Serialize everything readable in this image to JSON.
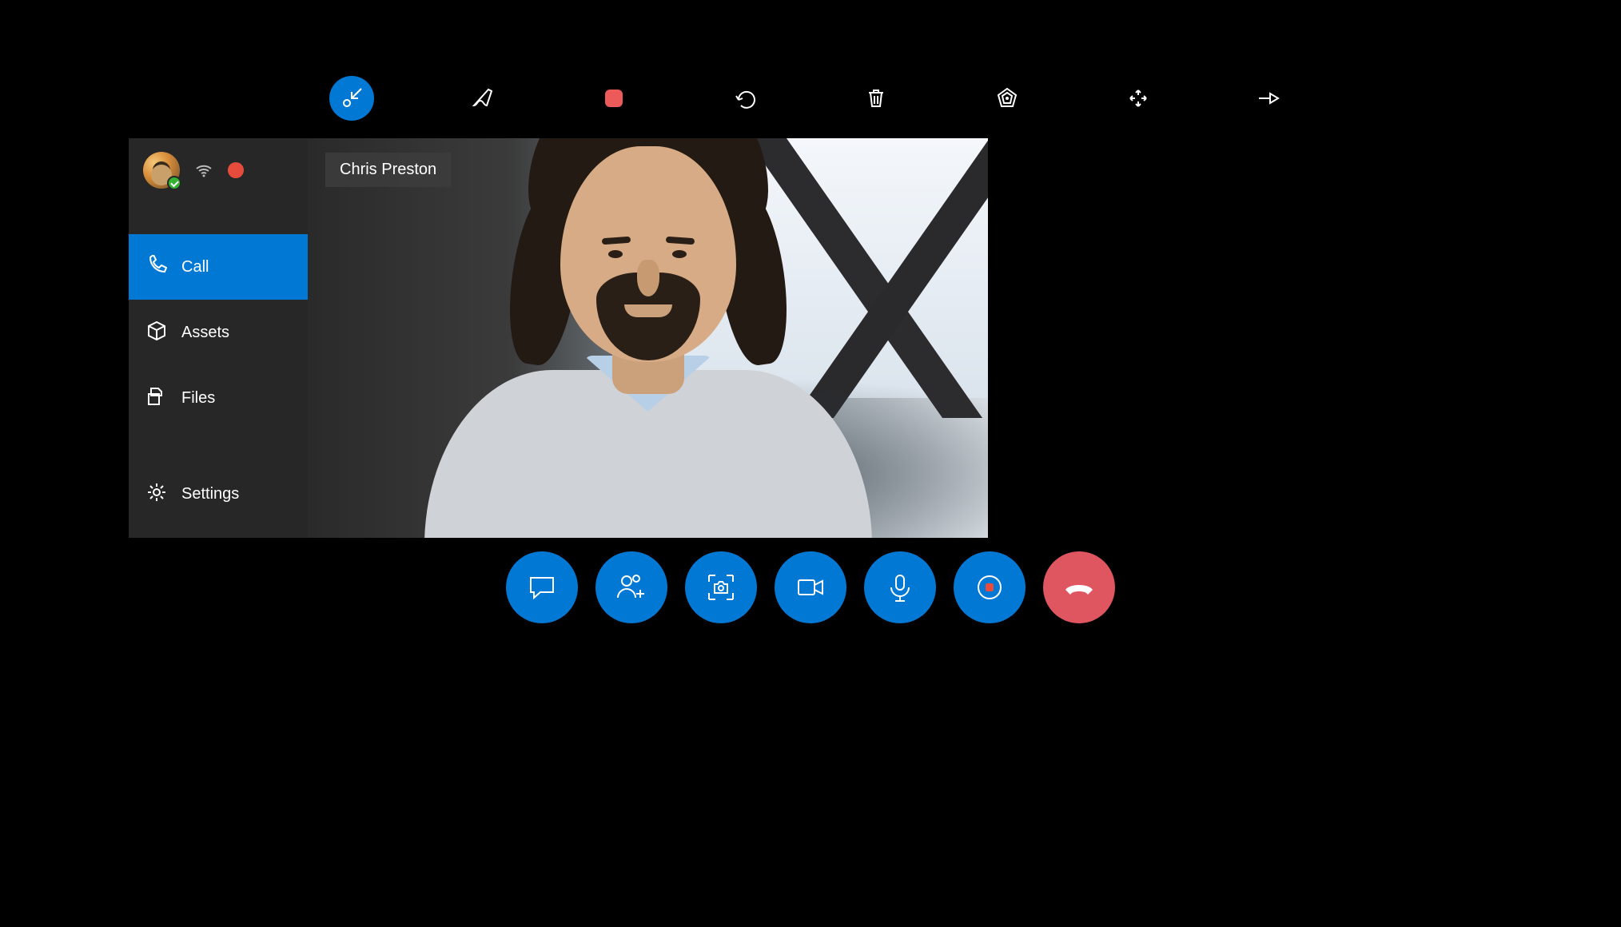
{
  "colors": {
    "accent": "#0078D4",
    "danger": "#e05660",
    "record": "#e74c3c",
    "stopSquare": "#EC5A5A"
  },
  "topToolbar": {
    "items": [
      {
        "name": "collapse-icon",
        "active": true
      },
      {
        "name": "pen-icon",
        "active": false
      },
      {
        "name": "stop-icon",
        "active": false
      },
      {
        "name": "undo-icon",
        "active": false
      },
      {
        "name": "trash-icon",
        "active": false
      },
      {
        "name": "polygon-icon",
        "active": false
      },
      {
        "name": "expand-icon",
        "active": false
      },
      {
        "name": "pin-icon",
        "active": false
      }
    ]
  },
  "sidebar": {
    "user": {
      "presence": "available",
      "recording": true
    },
    "items": [
      {
        "icon": "phone-icon",
        "label": "Call",
        "active": true
      },
      {
        "icon": "package-icon",
        "label": "Assets",
        "active": false
      },
      {
        "icon": "files-icon",
        "label": "Files",
        "active": false
      }
    ],
    "footer": {
      "icon": "gear-icon",
      "label": "Settings"
    }
  },
  "video": {
    "participantName": "Chris Preston"
  },
  "bottomBar": {
    "items": [
      {
        "name": "chat-icon"
      },
      {
        "name": "add-participant-icon"
      },
      {
        "name": "capture-icon"
      },
      {
        "name": "video-icon"
      },
      {
        "name": "mic-icon"
      },
      {
        "name": "record-icon"
      },
      {
        "name": "hangup-icon",
        "end": true
      }
    ]
  }
}
